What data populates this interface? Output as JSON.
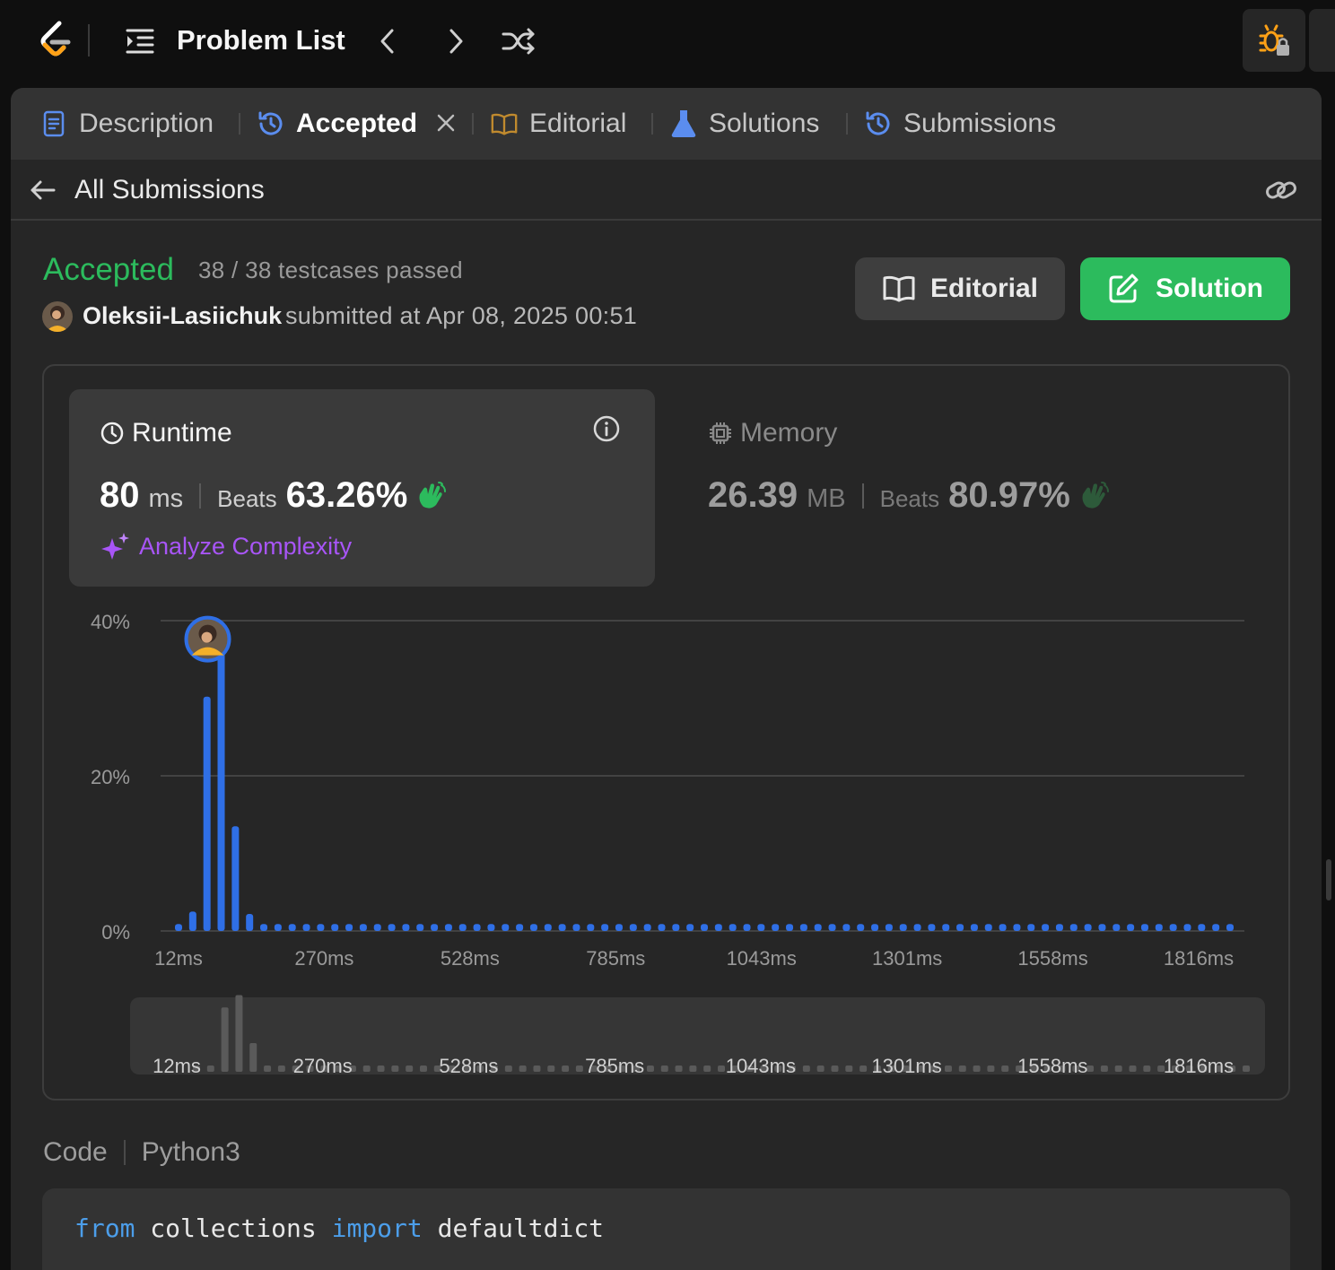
{
  "topbar": {
    "title": "Problem List"
  },
  "tabs": [
    {
      "label": "Description"
    },
    {
      "label": "Accepted"
    },
    {
      "label": "Editorial"
    },
    {
      "label": "Solutions"
    },
    {
      "label": "Submissions"
    }
  ],
  "subhead": {
    "back_label": "All Submissions"
  },
  "result": {
    "status": "Accepted",
    "testcases": "38 / 38 testcases passed",
    "username": "Oleksii-Lasiichuk",
    "submitted": "submitted at Apr 08, 2025 00:51",
    "editorial_btn": "Editorial",
    "solution_btn": "Solution"
  },
  "runtime": {
    "title": "Runtime",
    "value": "80",
    "unit": "ms",
    "beats_label": "Beats",
    "beats": "63.26%",
    "analyze": "Analyze Complexity"
  },
  "memory": {
    "title": "Memory",
    "value": "26.39",
    "unit": "MB",
    "beats_label": "Beats",
    "beats": "80.97%"
  },
  "colors": {
    "accepted": "#2cbb5d",
    "bar": "#2f6fe6",
    "analyze": "#a855f7"
  },
  "chart_data": {
    "type": "bar",
    "ylim": [
      0,
      40
    ],
    "yticks": [
      "40%",
      "20%",
      "0%"
    ],
    "xticks": [
      "12ms",
      "270ms",
      "528ms",
      "785ms",
      "1043ms",
      "1301ms",
      "1558ms",
      "1816ms"
    ],
    "grid": true,
    "values": [
      0.9,
      2.5,
      30.2,
      36.0,
      13.5,
      2.2,
      0.9,
      0.9,
      0.9,
      0.9,
      0.9,
      0.9,
      0.9,
      0.9,
      0.9,
      0.9,
      0.9,
      0.9,
      0.9,
      0.9,
      0.9,
      0.9,
      0.9,
      0.9,
      0.9,
      0.9,
      0.9,
      0.9,
      0.9,
      0.9,
      0.9,
      0.9,
      0.9,
      0.9,
      0.9,
      0.9,
      0.9,
      0.9,
      0.9,
      0.9,
      0.9,
      0.9,
      0.9,
      0.9,
      0.9,
      0.9,
      0.9,
      0.9,
      0.9,
      0.9,
      0.9,
      0.9,
      0.9,
      0.9,
      0.9,
      0.9,
      0.9,
      0.9,
      0.9,
      0.9,
      0.9,
      0.9,
      0.9,
      0.9,
      0.9,
      0.9,
      0.9,
      0.9,
      0.9,
      0.9,
      0.9,
      0.9,
      0.9,
      0.9,
      0.9
    ],
    "highlight_bin": 3,
    "overview_xticks": [
      "12ms",
      "270ms",
      "528ms",
      "785ms",
      "1043ms",
      "1301ms",
      "1558ms",
      "1816ms"
    ]
  },
  "code": {
    "label": "Code",
    "language": "Python3",
    "line1": [
      {
        "t": "from",
        "kw": true
      },
      {
        "t": " collections ",
        "kw": false
      },
      {
        "t": "import",
        "kw": true
      },
      {
        "t": " defaultdict",
        "kw": false
      }
    ]
  }
}
